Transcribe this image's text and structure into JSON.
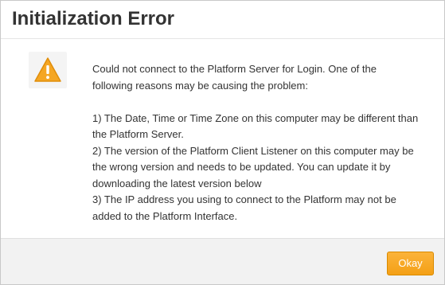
{
  "dialog": {
    "title": "Initialization Error",
    "icon": "warning-icon",
    "message": {
      "intro": "Could not connect to the Platform Server for Login. One of the following reasons may be causing the problem:",
      "reasons": [
        "1) The Date, Time or Time Zone on this computer may be different than the Platform Server.",
        "2) The version of the Platform Client Listener on this computer may be the wrong version and needs to be updated. You can update it by downloading the latest version below",
        "3) The IP address you using to connect to the Platform may not be added to the Platform Interface."
      ]
    },
    "okay_label": "Okay"
  },
  "colors": {
    "accent": "#f9a825",
    "warning": "#f5a623",
    "footer_bg": "#f2f2f2",
    "text": "#333333"
  }
}
